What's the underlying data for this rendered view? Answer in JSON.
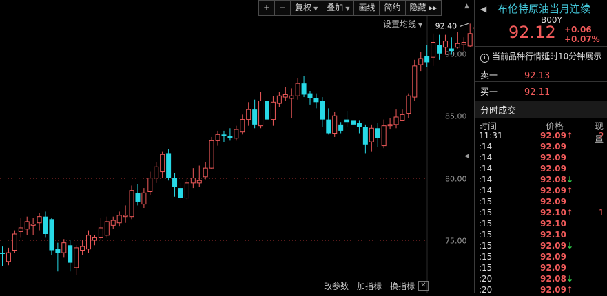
{
  "toolbar": {
    "plus": "+",
    "minus": "−",
    "fuquan": "复权",
    "diejia": "叠加",
    "huaxian": "画线",
    "jianyue": "简约",
    "yincang": "隐藏",
    "more": "▸▸"
  },
  "setting_label": "设置均线",
  "bottom": {
    "gaicanshu": "改参数",
    "jiazhibiao": "加指标",
    "huanzhibiao": "换指标",
    "close": "✕"
  },
  "panel": {
    "title": "布伦特原油当月连续",
    "code": "B00Y",
    "price": "92.12",
    "change": "+0.06",
    "change_pct": "+0.07%",
    "notice": "当前品种行情延时10分钟展示",
    "sell_label": "卖一",
    "sell_value": "92.13",
    "buy_label": "买一",
    "buy_value": "92.11",
    "section": "分时成交",
    "col_time": "时间",
    "col_price": "价格",
    "col_volume": "现量",
    "trades": [
      {
        "time": "11:31",
        "price": "92.09",
        "dir": "up",
        "vol": "2"
      },
      {
        "time": ":14",
        "price": "92.09",
        "dir": "",
        "vol": ""
      },
      {
        "time": ":14",
        "price": "92.09",
        "dir": "",
        "vol": ""
      },
      {
        "time": ":14",
        "price": "92.09",
        "dir": "",
        "vol": ""
      },
      {
        "time": ":14",
        "price": "92.08",
        "dir": "down",
        "vol": ""
      },
      {
        "time": ":14",
        "price": "92.09",
        "dir": "up",
        "vol": ""
      },
      {
        "time": ":15",
        "price": "92.09",
        "dir": "",
        "vol": ""
      },
      {
        "time": ":15",
        "price": "92.10",
        "dir": "up",
        "vol": "1"
      },
      {
        "time": ":15",
        "price": "92.10",
        "dir": "",
        "vol": ""
      },
      {
        "time": ":15",
        "price": "92.10",
        "dir": "",
        "vol": ""
      },
      {
        "time": ":15",
        "price": "92.09",
        "dir": "down",
        "vol": ""
      },
      {
        "time": ":15",
        "price": "92.09",
        "dir": "",
        "vol": ""
      },
      {
        "time": ":15",
        "price": "92.09",
        "dir": "",
        "vol": ""
      },
      {
        "time": ":20",
        "price": "92.08",
        "dir": "down",
        "vol": ""
      },
      {
        "time": ":20",
        "price": "92.09",
        "dir": "up",
        "vol": ""
      }
    ]
  },
  "chart_data": {
    "type": "candlestick",
    "y_ticks": [
      "90.00",
      "85.00",
      "80.00",
      "75.00"
    ],
    "ylim": [
      70.8,
      94.3
    ],
    "grid": true,
    "max_label": "92.40",
    "up_color": "#f05a5a",
    "down_color": "#27d9e6",
    "candles": [
      [
        74.0,
        73.9,
        74.5,
        72.9
      ],
      [
        73.3,
        74.0,
        74.4,
        73.0
      ],
      [
        74.2,
        75.5,
        75.8,
        74.0
      ],
      [
        75.7,
        76.0,
        76.8,
        75.2
      ],
      [
        75.9,
        76.5,
        76.9,
        75.4
      ],
      [
        76.2,
        76.3,
        76.8,
        75.4
      ],
      [
        76.4,
        76.9,
        77.2,
        75.8
      ],
      [
        76.9,
        75.5,
        77.3,
        75.2
      ],
      [
        76.7,
        74.2,
        76.8,
        73.8
      ],
      [
        74.3,
        74.0,
        74.8,
        72.5
      ],
      [
        74.0,
        74.8,
        75.1,
        73.6
      ],
      [
        74.6,
        73.2,
        75.0,
        72.5
      ],
      [
        72.8,
        74.4,
        74.6,
        72.2
      ],
      [
        74.2,
        74.5,
        75.0,
        73.8
      ],
      [
        74.3,
        75.4,
        75.8,
        74.0
      ],
      [
        75.0,
        75.2,
        75.4,
        74.6
      ],
      [
        75.2,
        76.0,
        76.8,
        75.0
      ],
      [
        75.4,
        76.5,
        76.9,
        75.2
      ],
      [
        76.2,
        76.6,
        76.9,
        75.9
      ],
      [
        76.4,
        77.0,
        77.3,
        76.1
      ],
      [
        76.9,
        77.0,
        77.8,
        76.4
      ],
      [
        76.9,
        79.0,
        79.4,
        76.7
      ],
      [
        78.8,
        78.1,
        79.5,
        77.8
      ],
      [
        77.9,
        78.8,
        79.2,
        77.6
      ],
      [
        78.9,
        80.0,
        80.5,
        78.6
      ],
      [
        80.0,
        80.9,
        81.3,
        79.6
      ],
      [
        80.5,
        81.9,
        82.1,
        80.0
      ],
      [
        82.0,
        80.0,
        82.3,
        79.8
      ],
      [
        80.0,
        79.3,
        80.4,
        78.5
      ],
      [
        79.2,
        78.4,
        79.6,
        78.2
      ],
      [
        78.4,
        79.6,
        80.0,
        78.3
      ],
      [
        79.6,
        80.0,
        80.8,
        79.2
      ],
      [
        79.6,
        79.8,
        81.0,
        79.3
      ],
      [
        80.1,
        80.8,
        81.3,
        79.9
      ],
      [
        80.8,
        83.0,
        83.3,
        80.7
      ],
      [
        83.0,
        83.5,
        83.8,
        82.6
      ],
      [
        83.5,
        83.4,
        83.8,
        82.9
      ],
      [
        83.4,
        83.2,
        84.0,
        83.0
      ],
      [
        83.2,
        83.9,
        84.2,
        83.0
      ],
      [
        83.7,
        84.7,
        85.1,
        83.5
      ],
      [
        84.7,
        85.5,
        86.1,
        84.2
      ],
      [
        85.5,
        84.3,
        86.3,
        84.0
      ],
      [
        84.2,
        86.2,
        86.9,
        84.0
      ],
      [
        86.2,
        84.7,
        86.7,
        84.4
      ],
      [
        84.7,
        86.1,
        86.6,
        84.2
      ],
      [
        86.0,
        86.6,
        86.9,
        85.7
      ],
      [
        86.5,
        86.7,
        87.3,
        86.2
      ],
      [
        86.4,
        86.6,
        87.2,
        84.8
      ],
      [
        86.6,
        87.6,
        88.0,
        86.3
      ],
      [
        87.6,
        86.7,
        88.2,
        86.5
      ],
      [
        86.8,
        86.4,
        87.0,
        85.9
      ],
      [
        86.4,
        86.1,
        86.8,
        85.6
      ],
      [
        86.2,
        84.7,
        86.5,
        84.1
      ],
      [
        84.7,
        83.6,
        85.6,
        83.5
      ],
      [
        83.6,
        85.0,
        85.3,
        83.3
      ],
      [
        84.3,
        83.8,
        84.5,
        83.6
      ],
      [
        84.7,
        84.5,
        85.4,
        84.1
      ],
      [
        84.6,
        84.3,
        85.3,
        84.1
      ],
      [
        84.4,
        84.1,
        84.6,
        83.6
      ],
      [
        84.1,
        82.7,
        84.3,
        82.0
      ],
      [
        82.9,
        84.0,
        84.3,
        82.1
      ],
      [
        84.0,
        83.2,
        84.4,
        82.5
      ],
      [
        82.6,
        84.2,
        84.7,
        82.4
      ],
      [
        84.2,
        84.3,
        84.8,
        83.9
      ],
      [
        84.3,
        84.9,
        85.5,
        84.0
      ],
      [
        84.6,
        85.1,
        85.5,
        84.6
      ],
      [
        85.2,
        86.6,
        86.8,
        84.8
      ],
      [
        86.5,
        89.0,
        89.5,
        86.2
      ],
      [
        89.1,
        89.6,
        90.1,
        88.6
      ],
      [
        89.8,
        89.3,
        90.7,
        88.9
      ],
      [
        89.7,
        90.9,
        91.6,
        89.0
      ],
      [
        90.7,
        90.0,
        91.5,
        89.5
      ],
      [
        90.5,
        91.0,
        91.5,
        89.9
      ],
      [
        90.4,
        90.2,
        91.3,
        89.9
      ],
      [
        90.5,
        90.8,
        91.7,
        90.4
      ],
      [
        90.7,
        90.9,
        91.3,
        90.2
      ],
      [
        90.6,
        91.6,
        92.4,
        90.5
      ],
      [
        92.0,
        92.1,
        92.3,
        91.9
      ]
    ]
  }
}
